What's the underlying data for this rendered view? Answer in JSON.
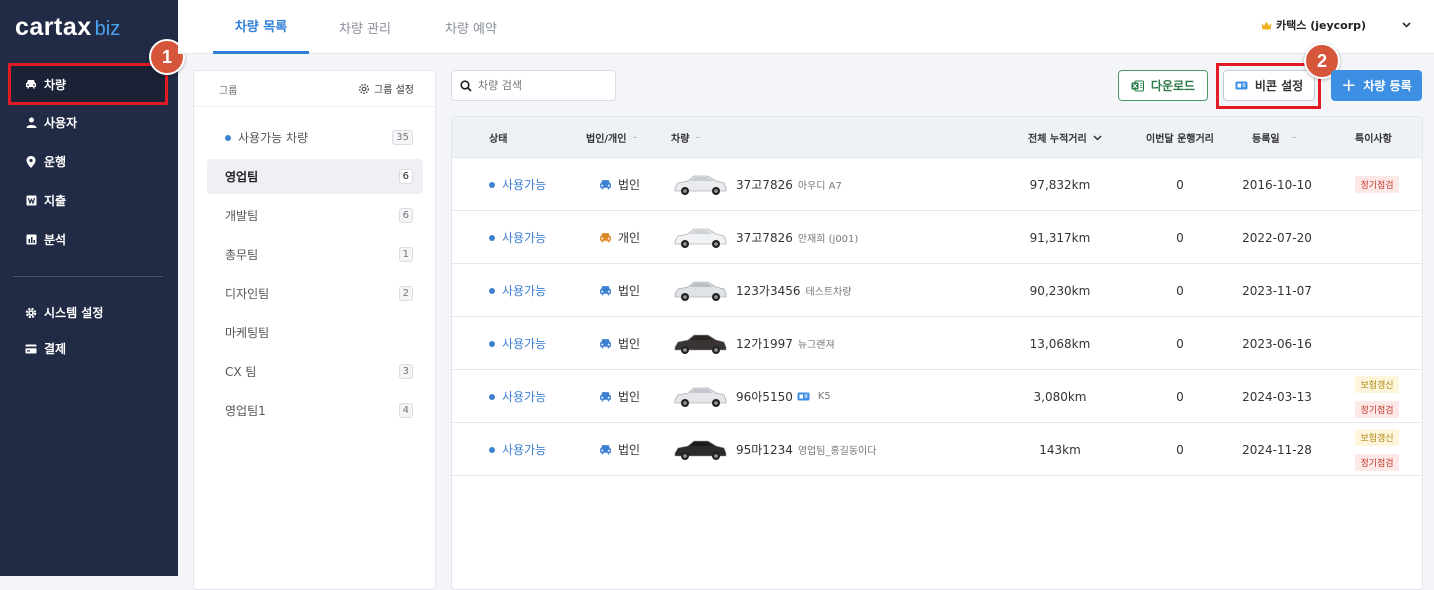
{
  "brand": {
    "logo_main": "cartax",
    "logo_sub": "biz"
  },
  "sidebar": {
    "items": [
      {
        "label": "차량",
        "icon": "car-icon",
        "active": true
      },
      {
        "label": "사용자",
        "icon": "person-icon"
      },
      {
        "label": "운행",
        "icon": "location-pin-icon"
      },
      {
        "label": "지출",
        "icon": "receipt-icon"
      },
      {
        "label": "분석",
        "icon": "chart-icon"
      }
    ],
    "bottom_items": [
      {
        "label": "시스템 설정",
        "icon": "gear-icon"
      },
      {
        "label": "결제",
        "icon": "card-icon"
      }
    ]
  },
  "callouts": [
    "1",
    "2"
  ],
  "tabs": [
    {
      "label": "차량 목록",
      "active": true
    },
    {
      "label": "차량 관리"
    },
    {
      "label": "차량 예약"
    }
  ],
  "user": {
    "name": "카택스 (jeycorp)"
  },
  "groups": {
    "header_label": "그룹",
    "settings_label": "그룹 설정",
    "items": [
      {
        "label": "사용가능 차량",
        "count": "35"
      },
      {
        "label": "영업팀",
        "count": "6",
        "active": true
      },
      {
        "label": "개발팀",
        "count": "6"
      },
      {
        "label": "총무팀",
        "count": "1"
      },
      {
        "label": "디자인팀",
        "count": "2"
      },
      {
        "label": "마케팅팀",
        "count": ""
      },
      {
        "label": "CX 팀",
        "count": "3"
      },
      {
        "label": "영업팀1",
        "count": "4"
      }
    ]
  },
  "search": {
    "placeholder": "차량 검색"
  },
  "toolbar": {
    "download": "다운로드",
    "beacon": "비콘 설정",
    "register": "차량 등록"
  },
  "table": {
    "headers": {
      "status": "상태",
      "ownership": "법인/개인",
      "vehicle": "차량",
      "mileage": "전체 누적거리",
      "monthly": "이번달 운행거리",
      "registered": "등록일",
      "notes": "특이사항"
    },
    "rows": [
      {
        "status": "사용가능",
        "ownership": "법인",
        "own_color": "#3d7fd0",
        "plate": "37고7826",
        "nick": "아우디 A7",
        "beacon": false,
        "mileage": "97,832km",
        "monthly": "0",
        "date": "2016-10-10",
        "tags": [
          {
            "text": "정기점검",
            "kind": "red"
          }
        ]
      },
      {
        "status": "사용가능",
        "ownership": "개인",
        "own_color": "#d9892a",
        "plate": "37고7826",
        "nick": "안재희 (j001)",
        "beacon": false,
        "mileage": "91,317km",
        "monthly": "0",
        "date": "2022-07-20",
        "tags": []
      },
      {
        "status": "사용가능",
        "ownership": "법인",
        "own_color": "#3d7fd0",
        "plate": "123가3456",
        "nick": "테스트차량",
        "beacon": false,
        "mileage": "90,230km",
        "monthly": "0",
        "date": "2023-11-07",
        "tags": []
      },
      {
        "status": "사용가능",
        "ownership": "법인",
        "own_color": "#3d7fd0",
        "plate": "12가1997",
        "nick": "뉴그랜져",
        "beacon": false,
        "mileage": "13,068km",
        "monthly": "0",
        "date": "2023-06-16",
        "tags": []
      },
      {
        "status": "사용가능",
        "ownership": "법인",
        "own_color": "#3d7fd0",
        "plate": "96아5150",
        "nick": "K5",
        "beacon": true,
        "mileage": "3,080km",
        "monthly": "0",
        "date": "2024-03-13",
        "tags": [
          {
            "text": "보험갱신",
            "kind": "yellow"
          },
          {
            "text": "정기점검",
            "kind": "red"
          }
        ]
      },
      {
        "status": "사용가능",
        "ownership": "법인",
        "own_color": "#3d7fd0",
        "plate": "95마1234",
        "nick": "영업팀_홍길동이다",
        "beacon": false,
        "mileage": "143km",
        "monthly": "0",
        "date": "2024-11-28",
        "tags": [
          {
            "text": "보험갱신",
            "kind": "yellow"
          },
          {
            "text": "정기점검",
            "kind": "red"
          }
        ]
      }
    ]
  }
}
